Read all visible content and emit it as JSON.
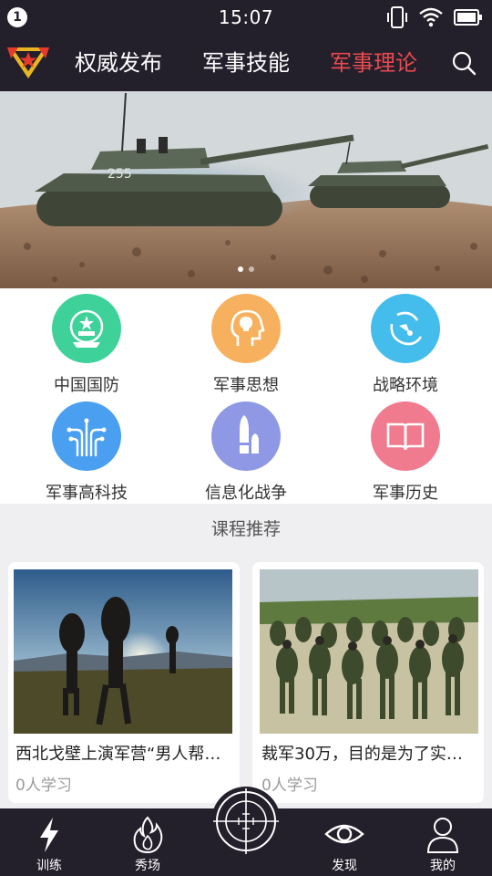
{
  "status_bar": {
    "notification_count": "1",
    "time": "15:07",
    "icons": [
      "vibrate-icon",
      "wifi-icon",
      "battery-icon"
    ]
  },
  "top_nav": {
    "tabs": [
      {
        "label": "权威发布",
        "active": false
      },
      {
        "label": "军事技能",
        "active": false
      },
      {
        "label": "军事理论",
        "active": true
      }
    ],
    "active_color": "#e84a4f",
    "bar_color": "#231f2b"
  },
  "banner": {
    "tank_number": "255",
    "page_count": 2,
    "current_page": 1
  },
  "categories": [
    {
      "label": "中国国防",
      "color": "#3ed29a",
      "icon": "national-emblem-icon"
    },
    {
      "label": "军事思想",
      "color": "#f7b15e",
      "icon": "thinking-head-icon"
    },
    {
      "label": "战略环境",
      "color": "#44bcec",
      "icon": "radar-icon"
    },
    {
      "label": "军事高科技",
      "color": "#4a9ff0",
      "icon": "circuit-icon"
    },
    {
      "label": "信息化战争",
      "color": "#8e98e4",
      "icon": "bullet-icon"
    },
    {
      "label": "军事历史",
      "color": "#f07b8e",
      "icon": "book-icon"
    }
  ],
  "section_title": "课程推荐",
  "courses": [
    {
      "title": "西北戈壁上演军营“男人帮…",
      "learners": "0人学习"
    },
    {
      "title": "裁军30万，目的是为了实…",
      "learners": "0人学习"
    }
  ],
  "bottom_nav": {
    "items": [
      {
        "label": "训练",
        "icon": "lightning-icon"
      },
      {
        "label": "秀场",
        "icon": "flame-icon"
      },
      {
        "label": "发现",
        "icon": "eye-icon"
      },
      {
        "label": "我的",
        "icon": "user-icon"
      }
    ],
    "center_icon": "crosshair-icon"
  }
}
